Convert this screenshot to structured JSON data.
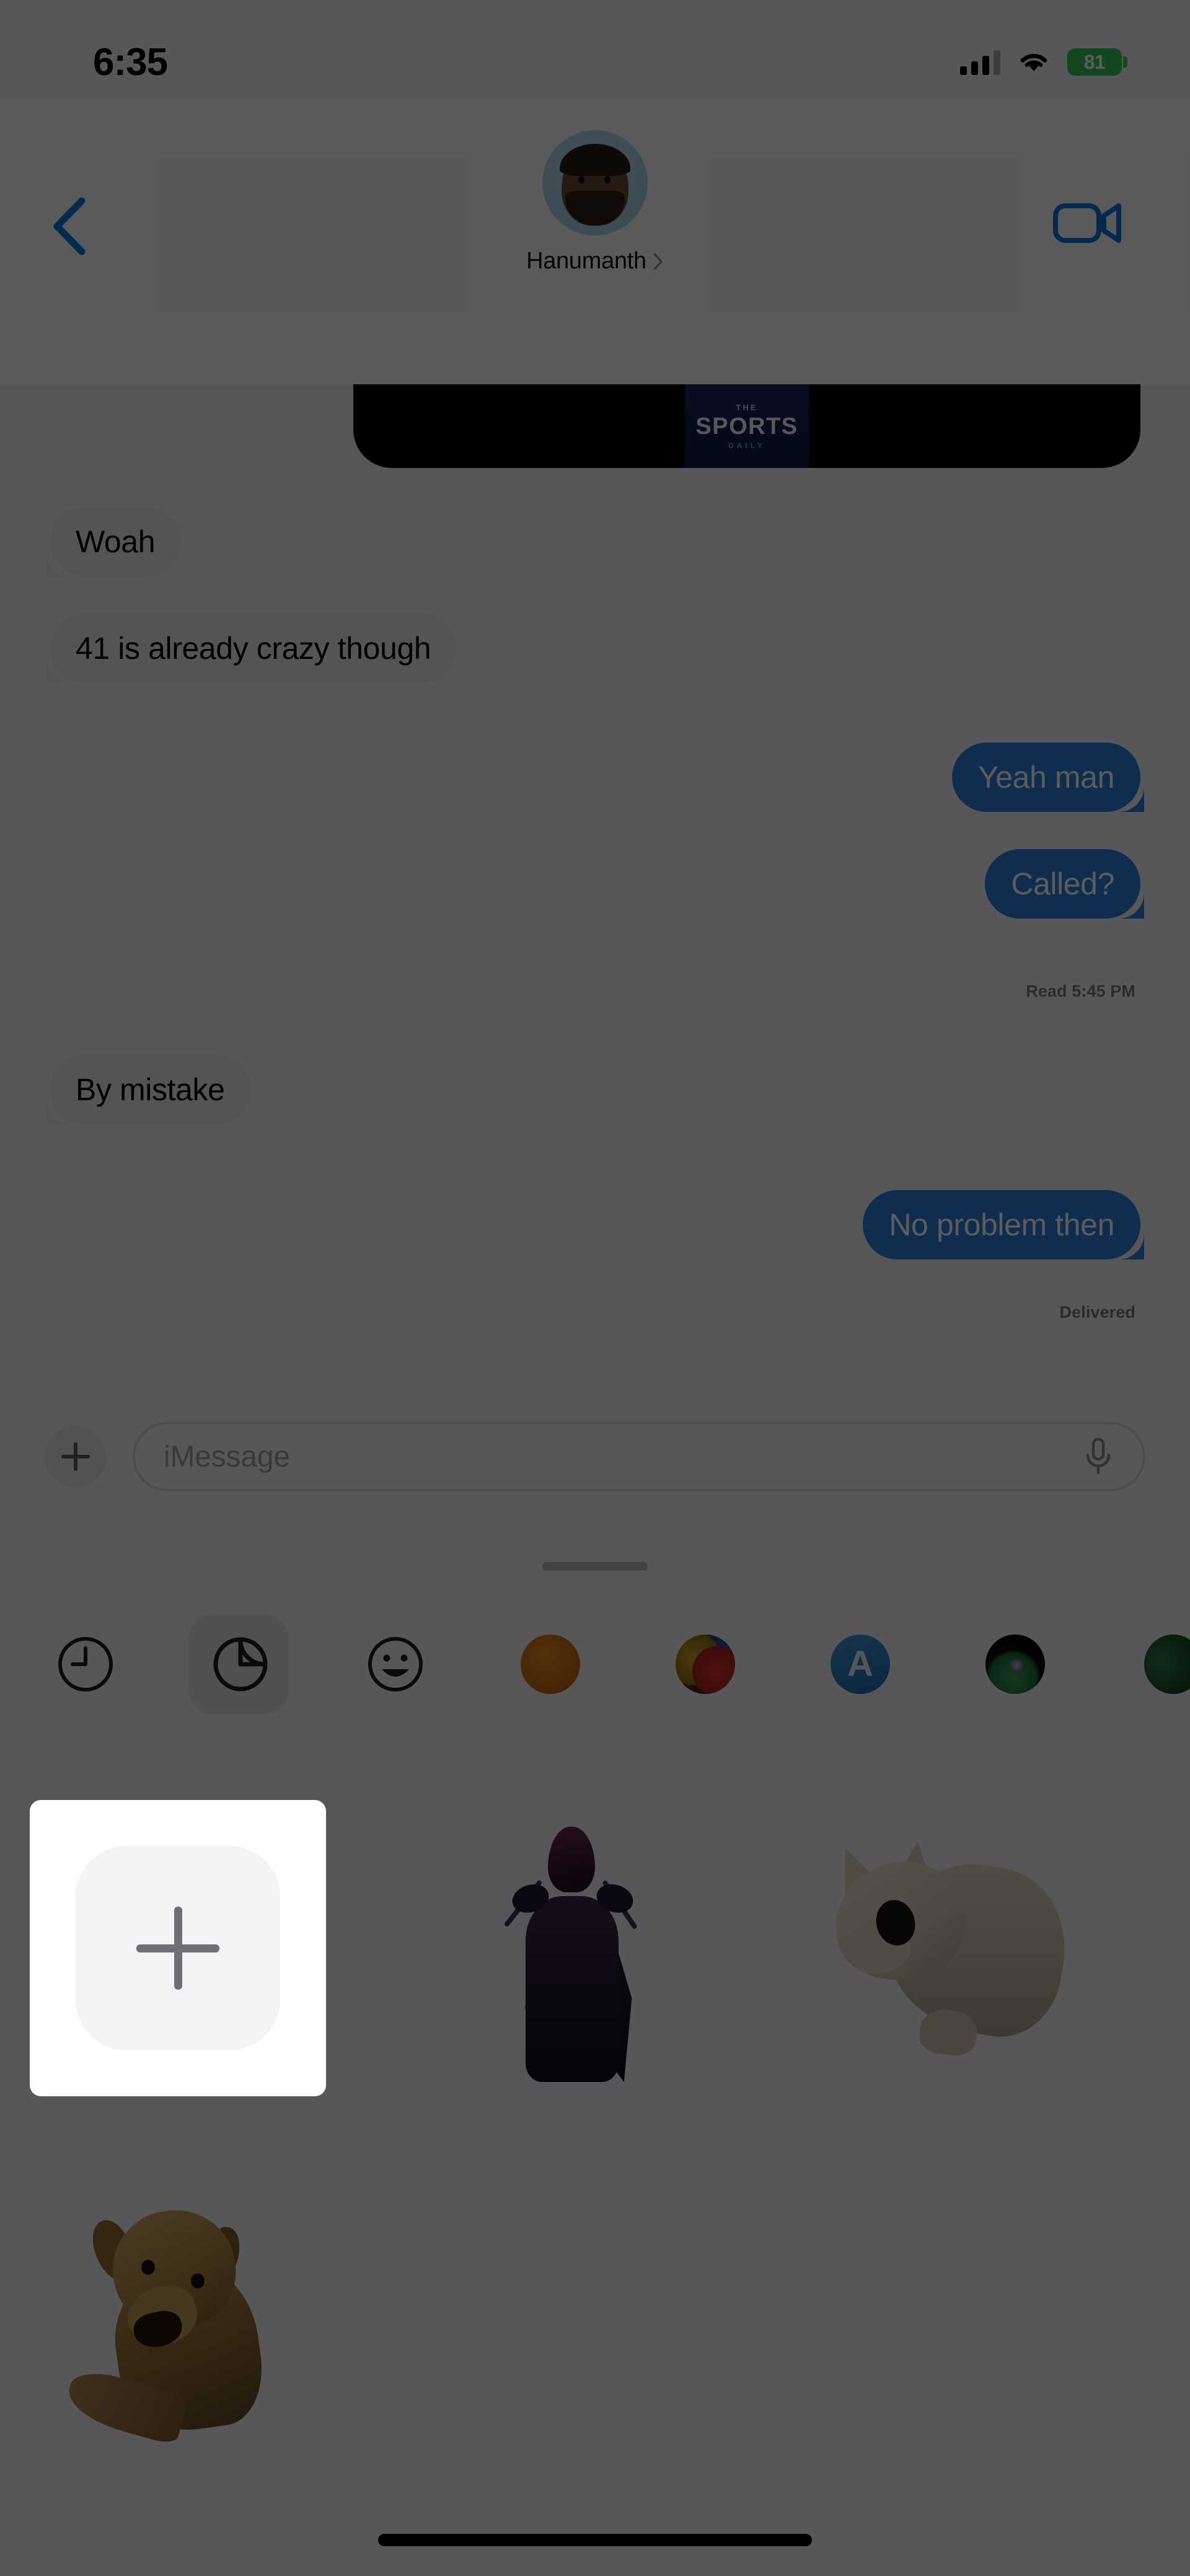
{
  "status_bar": {
    "time": "6:35",
    "battery_level": "81",
    "battery_color": "#34c759",
    "signal_icon": "cellular-signal-icon",
    "wifi_icon": "wifi-icon"
  },
  "nav_header": {
    "back_icon": "back-chevron-icon",
    "contact_name": "Hanumanth",
    "contact_chevron": "›",
    "avatar_alt": "memoji-avatar",
    "video_call_icon": "video-camera-icon"
  },
  "thread": {
    "link_preview": {
      "logo_tiny": "THE",
      "logo_main": "SPORTS",
      "logo_sub": "DAILY"
    },
    "messages": [
      {
        "id": "woah",
        "text": "Woah",
        "side": "received"
      },
      {
        "id": "41",
        "text": "41 is already crazy though",
        "side": "received"
      },
      {
        "id": "yeah",
        "text": "Yeah man",
        "side": "sent"
      },
      {
        "id": "called",
        "text": "Called?",
        "side": "sent"
      },
      {
        "id": "mistake",
        "text": "By mistake",
        "side": "received"
      },
      {
        "id": "noprob",
        "text": "No problem then",
        "side": "sent"
      }
    ],
    "read_receipt": "Read 5:45 PM",
    "delivered_receipt": "Delivered"
  },
  "input_bar": {
    "plus_icon": "plus-icon",
    "placeholder": "iMessage",
    "mic_icon": "microphone-icon"
  },
  "drag_handle": "drawer-drag-handle",
  "app_drawer": {
    "items": [
      {
        "id": "recents",
        "icon": "clock-icon",
        "label": "Recents",
        "selected": false
      },
      {
        "id": "stickers",
        "icon": "sticker-peel-icon",
        "label": "Stickers",
        "selected": true
      },
      {
        "id": "emoji",
        "icon": "smiley-icon",
        "label": "Emoji",
        "selected": false
      },
      {
        "id": "orange",
        "icon": "orange-app-icon",
        "label": "App",
        "selected": false
      },
      {
        "id": "photos",
        "icon": "photos-app-icon",
        "label": "Photos",
        "selected": false
      },
      {
        "id": "appstore",
        "icon": "app-store-icon",
        "label": "App Store",
        "selected": false,
        "letter": "A"
      },
      {
        "id": "dark",
        "icon": "dark-app-icon",
        "label": "App",
        "selected": false
      },
      {
        "id": "partial",
        "icon": "partial-app-icon",
        "label": "App",
        "selected": false
      }
    ]
  },
  "sticker_grid": {
    "add_button_icon": "plus-icon",
    "add_button_label": "Add sticker",
    "stickers": [
      {
        "id": "knight",
        "alt": "dark-armored-character-sticker"
      },
      {
        "id": "cat",
        "alt": "cat-cutout-sticker"
      },
      {
        "id": "dog",
        "alt": "dog-cutout-sticker"
      }
    ]
  },
  "home_indicator": "home-indicator",
  "colors": {
    "sent_bubble": "#2b7cd9",
    "received_bubble": "#e9e9eb",
    "accent_blue": "#007aff",
    "dim_overlay": "rgba(0,0,0,0.64)"
  }
}
